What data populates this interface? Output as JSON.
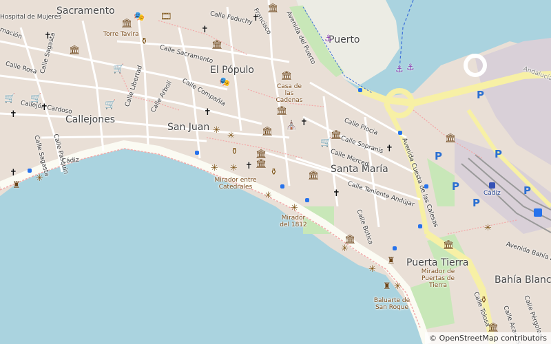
{
  "districts": {
    "sacramento": "Sacramento",
    "el_populo": "El Pópulo",
    "callejones": "Callejones",
    "san_juan": "San Juan",
    "santa_maria": "Santa María",
    "puerto": "Puerto",
    "puerta_tierra": "Puerta Tierra",
    "bahia_blanca": "Bahía Blanc"
  },
  "streets": {
    "hospital_de_mujeres": "Hospital de Mujeres",
    "encarnacion": "rnación",
    "calle_feduchy": "Calle Feduchy",
    "calle_sacramento": "Calle Sacramento",
    "calle_rosa": "Calle Rosa",
    "calle_sagasta": "Calle Sagasta",
    "calle_sagasta_2": "Calle Sagasta",
    "callejon_cardoso": "Callejón Cardoso",
    "calle_pasquin": "Calle Pasquín",
    "calle_libertad": "Calle Libertad",
    "calle_arboli": "Calle Arbolí",
    "calle_compania": "Calle Compañía",
    "calle_francisco": "Francisco",
    "avenida_del_puerto": "Avenida del Puerto",
    "calle_plocia": "Calle Plocia",
    "calle_sopranis": "Calle Sopranis",
    "calle_merced": "Calle Merced",
    "calle_teniente_andujar": "Calle Teniente Andújar",
    "calle_botica": "Calle Botica",
    "avenida_cuesta": "Avenida Cuesta de las Calesas",
    "avenida_bahia": "Avenida Bahía B",
    "calle_acacias": "Calle Acacias",
    "calle_pergolas": "Calle Pérgolas",
    "calle_tolosa": "Calle Tolosa",
    "cadiz_road": "Cádiz",
    "andalucia": "Andalucía"
  },
  "pois": {
    "torre_tavira": "Torre Tavira",
    "casa_cadenas": "Casa de las Cadenas",
    "mirador_catedrales": "Mirador entre Catedrales",
    "mirador_1812": "Mirador del 1812",
    "mirador_puertas": "Mirador de Puertas de Tierra",
    "baluarte": "Baluarte de San Roque",
    "cadiz_station": "Cádiz"
  },
  "parking_label": "P",
  "attribution": "© OpenStreetMap contributors",
  "colors": {
    "sea": "#aad3df",
    "land": "#e9dfd6",
    "park": "#c8e7b8",
    "road_major": "#f8f3a6",
    "rail": "#999999"
  }
}
